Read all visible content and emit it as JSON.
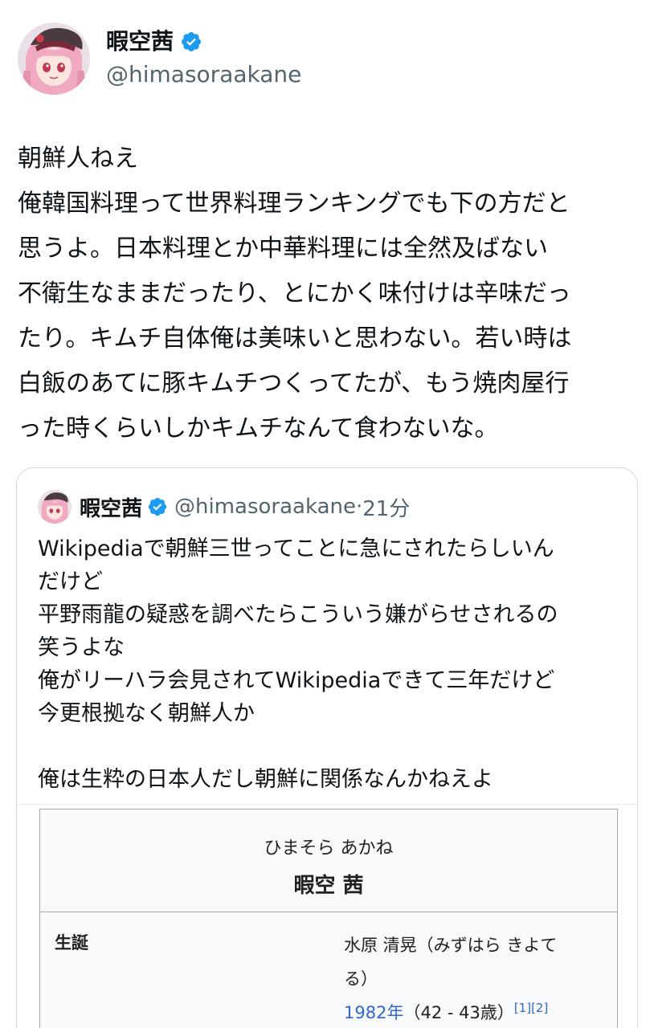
{
  "author": {
    "display_name": "暇空茜",
    "handle": "@himasoraakane"
  },
  "tweet": {
    "lines": [
      "朝鮮人ねえ",
      "俺韓国料理って世界料理ランキングでも下の方だと",
      "思うよ。日本料理とか中華料理には全然及ばない",
      "不衛生なままだったり、とにかく味付けは辛味だっ",
      "たり。キムチ自体俺は美味いと思わない。若い時は",
      "白飯のあてに豚キムチつくってたが、もう焼肉屋行",
      "った時くらいしかキムチなんて食わないな。"
    ]
  },
  "quoted": {
    "display_name": "暇空茜",
    "handle": "@himasoraakane",
    "dot": "·",
    "time": "21分",
    "lines": [
      "Wikipediaで朝鮮三世ってことに急にされたらしいん",
      "だけど",
      "平野雨龍の疑惑を調べたらこういう嫌がらせされるの",
      "笑うよな",
      "俺がリーハラ会見されてWikipediaできて三年だけど",
      "今更根拠なく朝鮮人か",
      "",
      "俺は生粋の日本人だし朝鮮に関係なんかねえよ"
    ],
    "infobox": {
      "kana": "ひまそら あかね",
      "name": "暇空 茜",
      "row_label": "生誕",
      "birth_name_1": "水原 清晃（みずはら きよて",
      "birth_name_2": "る）",
      "year_link": "1982年",
      "age": "（42 - 43歳）",
      "refs": "[1][2]"
    }
  },
  "colors": {
    "text": "#0f1419",
    "secondary": "#536471",
    "verified": "#1d9bf0",
    "link": "#3366cc"
  },
  "icons": {
    "verified": "verified-badge-icon",
    "avatar": "anime-avatar"
  }
}
